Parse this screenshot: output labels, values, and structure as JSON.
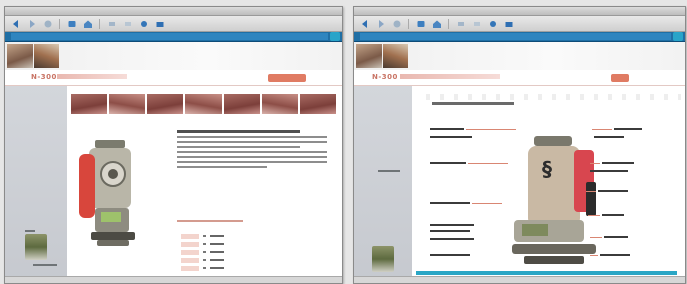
{
  "windows": [
    {
      "id": "product-page",
      "title": "",
      "brand": {
        "model": "N-300"
      },
      "toolbar_icons": [
        "back-icon",
        "forward-icon",
        "stop-icon",
        "refresh-icon",
        "home-icon",
        "search-icon",
        "favorites-icon",
        "history-icon",
        "print-icon",
        "mail-icon"
      ]
    },
    {
      "id": "component-page",
      "title": "",
      "brand": {
        "model": "N-300"
      },
      "toolbar_icons": [
        "back-icon",
        "forward-icon",
        "stop-icon",
        "refresh-icon",
        "home-icon",
        "search-icon",
        "favorites-icon",
        "history-icon",
        "print-icon",
        "mail-icon"
      ]
    }
  ],
  "colors": {
    "accent": "#e07b63",
    "address_bar": "#1f6fa5",
    "sidebar": "#cfd2d7",
    "instrument_red": "#d8463c",
    "cyan": "#2aa6c5"
  }
}
